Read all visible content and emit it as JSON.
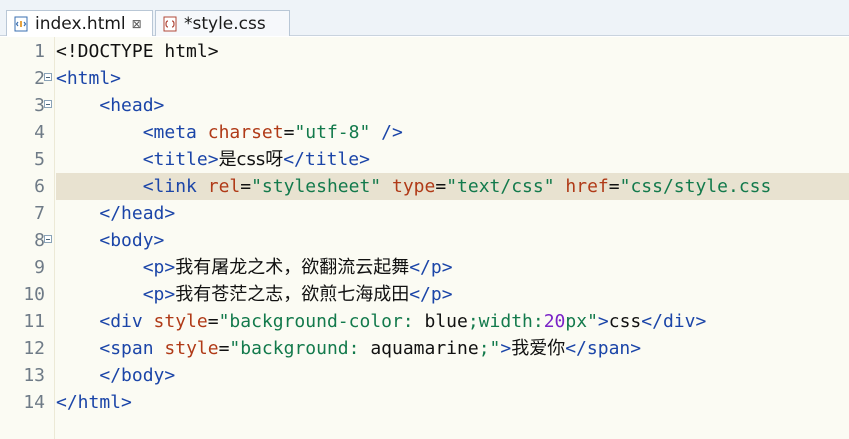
{
  "tabs": [
    {
      "label": "index.html",
      "close": "⊠",
      "icon": "html-file-icon",
      "active": true
    },
    {
      "label": "*style.css",
      "icon": "css-file-icon",
      "active": false
    }
  ],
  "highlighted_line": 6,
  "lines": [
    {
      "num": "1",
      "fold": false,
      "tokens": [
        {
          "t": "txt",
          "s": "<!DOCTYPE html>"
        }
      ]
    },
    {
      "num": "2",
      "fold": true,
      "tokens": [
        {
          "t": "tag",
          "s": "<html>"
        }
      ]
    },
    {
      "num": "3",
      "fold": true,
      "tokens": [
        {
          "t": "txt",
          "s": "    "
        },
        {
          "t": "tag",
          "s": "<head>"
        }
      ]
    },
    {
      "num": "4",
      "fold": false,
      "tokens": [
        {
          "t": "txt",
          "s": "        "
        },
        {
          "t": "tag",
          "s": "<meta "
        },
        {
          "t": "attr",
          "s": "charset"
        },
        {
          "t": "txt",
          "s": "="
        },
        {
          "t": "val",
          "s": "\"utf-8\""
        },
        {
          "t": "tag",
          "s": " />"
        }
      ]
    },
    {
      "num": "5",
      "fold": false,
      "tokens": [
        {
          "t": "txt",
          "s": "        "
        },
        {
          "t": "tag",
          "s": "<title>"
        },
        {
          "t": "txt",
          "s": "是css呀"
        },
        {
          "t": "tag",
          "s": "</title>"
        }
      ]
    },
    {
      "num": "6",
      "fold": false,
      "tokens": [
        {
          "t": "txt",
          "s": "        "
        },
        {
          "t": "tag",
          "s": "<link "
        },
        {
          "t": "attr",
          "s": "rel"
        },
        {
          "t": "txt",
          "s": "="
        },
        {
          "t": "val",
          "s": "\"stylesheet\""
        },
        {
          "t": "txt",
          "s": " "
        },
        {
          "t": "attr",
          "s": "type"
        },
        {
          "t": "txt",
          "s": "="
        },
        {
          "t": "val",
          "s": "\"text/css\""
        },
        {
          "t": "txt",
          "s": " "
        },
        {
          "t": "attr",
          "s": "href"
        },
        {
          "t": "txt",
          "s": "="
        },
        {
          "t": "val",
          "s": "\"css/style.css"
        }
      ]
    },
    {
      "num": "7",
      "fold": false,
      "tokens": [
        {
          "t": "txt",
          "s": "    "
        },
        {
          "t": "tag",
          "s": "</head>"
        }
      ]
    },
    {
      "num": "8",
      "fold": true,
      "tokens": [
        {
          "t": "txt",
          "s": "    "
        },
        {
          "t": "tag",
          "s": "<body>"
        }
      ]
    },
    {
      "num": "9",
      "fold": false,
      "tokens": [
        {
          "t": "txt",
          "s": "        "
        },
        {
          "t": "tag",
          "s": "<p>"
        },
        {
          "t": "txt",
          "s": "我有屠龙之术，欲翻流云起舞"
        },
        {
          "t": "tag",
          "s": "</p>"
        }
      ]
    },
    {
      "num": "10",
      "fold": false,
      "tokens": [
        {
          "t": "txt",
          "s": "        "
        },
        {
          "t": "tag",
          "s": "<p>"
        },
        {
          "t": "txt",
          "s": "我有苍茫之志，欲煎七海成田"
        },
        {
          "t": "tag",
          "s": "</p>"
        }
      ]
    },
    {
      "num": "11",
      "fold": false,
      "tokens": [
        {
          "t": "txt",
          "s": "    "
        },
        {
          "t": "tag",
          "s": "<div "
        },
        {
          "t": "attr",
          "s": "style"
        },
        {
          "t": "txt",
          "s": "="
        },
        {
          "t": "val",
          "s": "\"background-color: "
        },
        {
          "t": "txt",
          "s": "blue"
        },
        {
          "t": "val",
          "s": ";width:"
        },
        {
          "t": "num",
          "s": "20"
        },
        {
          "t": "val",
          "s": "px\""
        },
        {
          "t": "tag",
          "s": ">"
        },
        {
          "t": "txt",
          "s": "css"
        },
        {
          "t": "tag",
          "s": "</div>"
        }
      ]
    },
    {
      "num": "12",
      "fold": false,
      "tokens": [
        {
          "t": "txt",
          "s": "    "
        },
        {
          "t": "tag",
          "s": "<span "
        },
        {
          "t": "attr",
          "s": "style"
        },
        {
          "t": "txt",
          "s": "="
        },
        {
          "t": "val",
          "s": "\"background: "
        },
        {
          "t": "txt",
          "s": "aquamarine"
        },
        {
          "t": "val",
          "s": ";\""
        },
        {
          "t": "tag",
          "s": ">"
        },
        {
          "t": "txt",
          "s": "我爱你"
        },
        {
          "t": "tag",
          "s": "</span>"
        }
      ]
    },
    {
      "num": "13",
      "fold": false,
      "tokens": [
        {
          "t": "txt",
          "s": "    "
        },
        {
          "t": "tag",
          "s": "</body>"
        }
      ]
    },
    {
      "num": "14",
      "fold": false,
      "tokens": [
        {
          "t": "tag",
          "s": "</html>"
        }
      ]
    }
  ]
}
